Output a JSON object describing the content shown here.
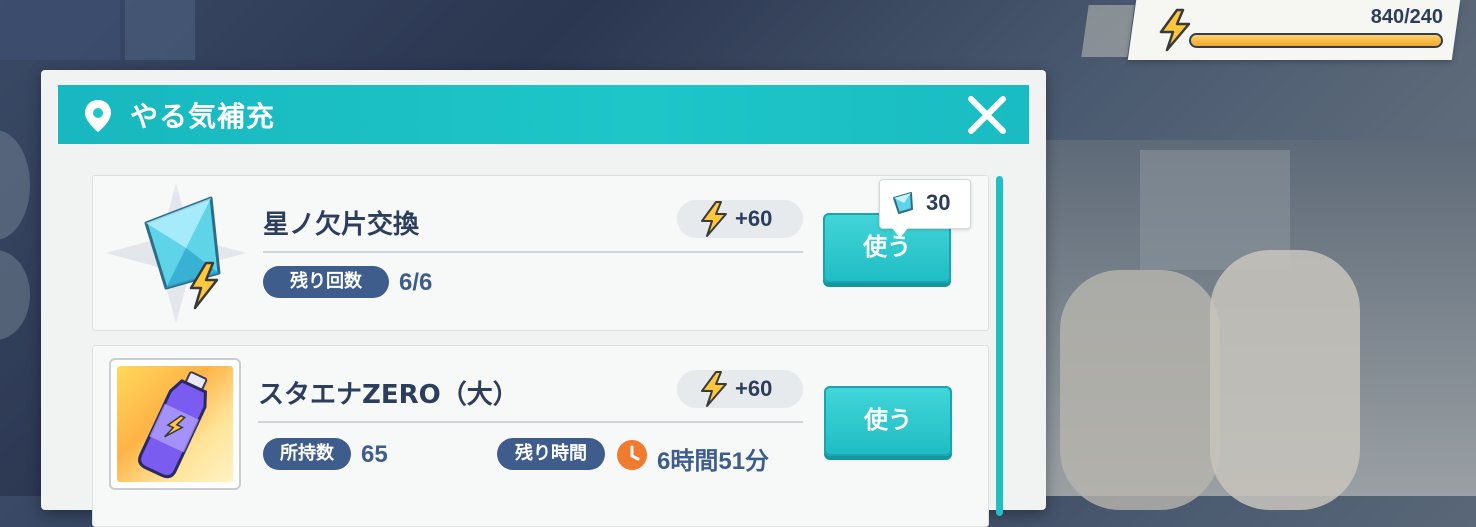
{
  "hud": {
    "stamina_text": "840/240",
    "stamina_fill_fraction": 1.0,
    "icon": "lightning-bolt-icon"
  },
  "dialog": {
    "title": "やる気補充",
    "title_icon": "location-pin-icon",
    "close_icon": "close-icon"
  },
  "items": [
    {
      "name": "星ノ欠片交換",
      "icon": "star-shard-icon",
      "gain": "+60",
      "label": "残り回数",
      "value": "6/6",
      "cost": "30",
      "button": "使う"
    },
    {
      "name": "スタエナZERO（大）",
      "icon": "energy-drink-icon",
      "gain": "+60",
      "label": "所持数",
      "value": "65",
      "timer_label": "残り時間",
      "timer_value": "6時間51分",
      "button": "使う"
    }
  ],
  "colors": {
    "accent": "#1ec6c8",
    "text_dark": "#2c3e5c",
    "pill_blue": "#3e5c8c",
    "bolt_yellow": "#ffc83a",
    "clock_orange": "#f07a30"
  }
}
